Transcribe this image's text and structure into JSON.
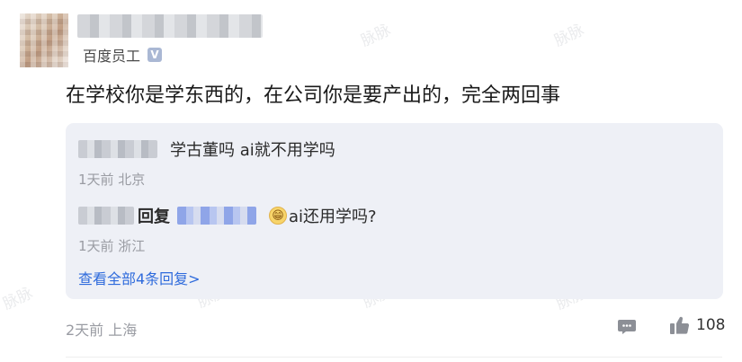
{
  "author": {
    "tag_label": "百度员工",
    "badge": "V"
  },
  "post": {
    "text": "在学校你是学东西的，在公司你是要产出的，完全两回事"
  },
  "replies": [
    {
      "text": "学古董吗 ai就不用学吗",
      "meta": "1天前 北京"
    },
    {
      "reply_word": "回复",
      "emoji": "😁",
      "text": "ai还用学吗?",
      "meta": "1天前 浙江"
    }
  ],
  "view_all_label": "查看全部4条回复>",
  "footer": {
    "meta": "2天前 上海",
    "like_count": "108"
  },
  "watermark": "脉脉",
  "colors": {
    "link": "#2f6bdc",
    "reply_bg": "#eef0f6",
    "meta": "#9a9ca3"
  }
}
